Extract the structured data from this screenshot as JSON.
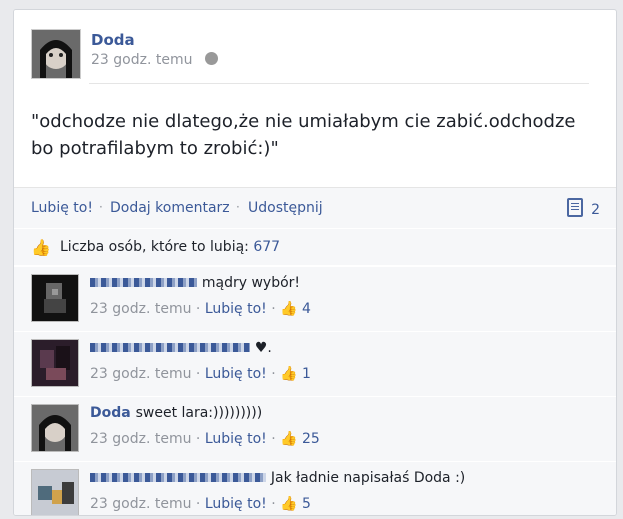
{
  "post": {
    "author": "Doda",
    "timestamp": "23 godz. temu",
    "text": "\"odchodze nie dlatego,że nie umiałabym cie zabić.odchodze bo potrafilabym to zrobić:)\"",
    "privacy_icon": "globe-icon"
  },
  "actions": {
    "like": "Lubię to!",
    "comment": "Dodaj komentarz",
    "share": "Udostępnij",
    "comment_count": "2"
  },
  "likes": {
    "label": "Liczba osób, które to lubią:",
    "count": "677"
  },
  "comments": [
    {
      "author": "",
      "text": "mądry wybór!",
      "time": "23 godz. temu",
      "like": "Lubię to!",
      "likes": "4"
    },
    {
      "author": "",
      "text": "♥.",
      "time": "23 godz. temu",
      "like": "Lubię to!",
      "likes": "1"
    },
    {
      "author": "Doda",
      "text": "sweet lara:)))))))))",
      "time": "23 godz. temu",
      "like": "Lubię to!",
      "likes": "25"
    },
    {
      "author": "",
      "text": "Jak ładnie napisałaś Doda :)",
      "time": "23 godz. temu",
      "like": "Lubię to!",
      "likes": "5"
    }
  ],
  "colors": {
    "link": "#3b5998",
    "muted": "#90949c",
    "panel": "#f6f7f9"
  }
}
